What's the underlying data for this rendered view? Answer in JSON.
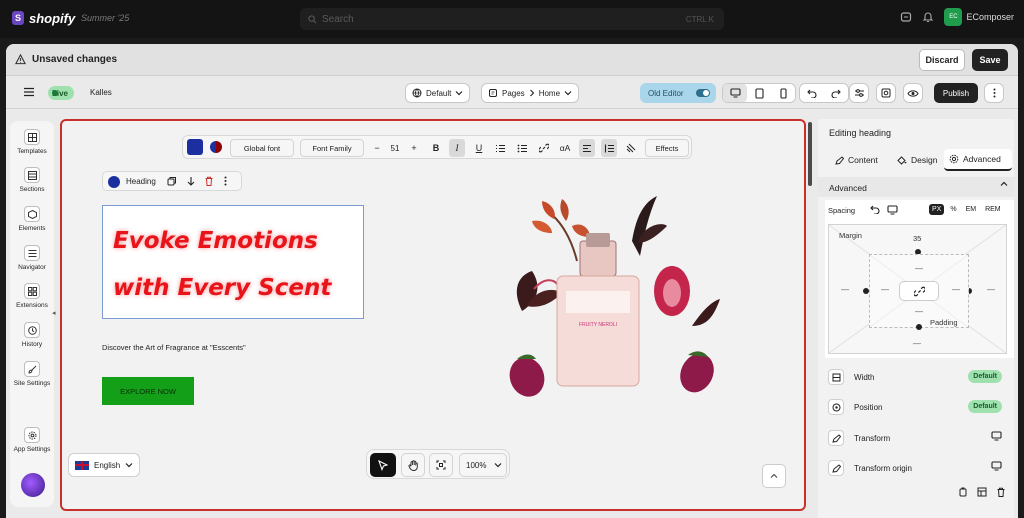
{
  "topbar": {
    "brand": "shopify",
    "edition": "Summer '25",
    "search_placeholder": "Search",
    "shortcut": "CTRL  K",
    "account_initials": "EC",
    "account_name": "EComposer"
  },
  "savebar": {
    "status": "Unsaved changes",
    "discard": "Discard",
    "save": "Save"
  },
  "toolbar": {
    "live": "Live",
    "store": "Kalles",
    "theme": "Default",
    "pages": "Pages",
    "page": "Home",
    "old_editor": "Old Editor",
    "publish": "Publish"
  },
  "sidebar": {
    "items": [
      {
        "label": "Templates",
        "icon": "templates-icon"
      },
      {
        "label": "Sections",
        "icon": "sections-icon"
      },
      {
        "label": "Elements",
        "icon": "elements-icon"
      },
      {
        "label": "Navigator",
        "icon": "navigator-icon"
      },
      {
        "label": "Extensions",
        "icon": "extensions-icon"
      },
      {
        "label": "History",
        "icon": "history-icon"
      },
      {
        "label": "Site Settings",
        "icon": "brush-icon"
      },
      {
        "label": "App Settings",
        "icon": "gear-icon"
      }
    ]
  },
  "text_toolbar": {
    "global_font": "Global font",
    "font_family": "Font Family",
    "size": "51",
    "effects": "Effects"
  },
  "element_chip": {
    "label": "Heading"
  },
  "canvas": {
    "heading_line1": "Evoke Emotions",
    "heading_line2": "with Every Scent",
    "subtext": "Discover the Art of Fragrance at \"Esscents\"",
    "cta": "EXPLORE NOW",
    "bottle_label": "FRUITY NEROLI",
    "language": "English",
    "zoom": "100%"
  },
  "panel": {
    "title": "Editing heading",
    "tabs": {
      "content": "Content",
      "design": "Design",
      "advanced": "Advanced"
    },
    "section": "Advanced",
    "spacing": {
      "label": "Spacing",
      "units": [
        "PX",
        "%",
        "EM",
        "REM"
      ],
      "active_unit": "PX",
      "margin_label": "Margin",
      "padding_label": "Padding",
      "margin_top": "35",
      "margin_right": "—",
      "margin_bottom": "—",
      "margin_left": "—",
      "padding_top": "—",
      "padding_right": "—",
      "padding_bottom": "—",
      "padding_left": "—"
    },
    "rows": [
      {
        "label": "Width",
        "badge": "Default",
        "icon": "width-icon"
      },
      {
        "label": "Position",
        "badge": "Default",
        "icon": "position-icon"
      },
      {
        "label": "Transform",
        "badge": "",
        "icon": "pen-icon"
      },
      {
        "label": "Transform origin",
        "badge": "",
        "icon": "pen-icon"
      }
    ]
  },
  "colors": {
    "accent_red": "#e8141a",
    "cta_green": "#13a018",
    "live_green": "#9fe1ae",
    "canvas_border": "#c9302c"
  }
}
